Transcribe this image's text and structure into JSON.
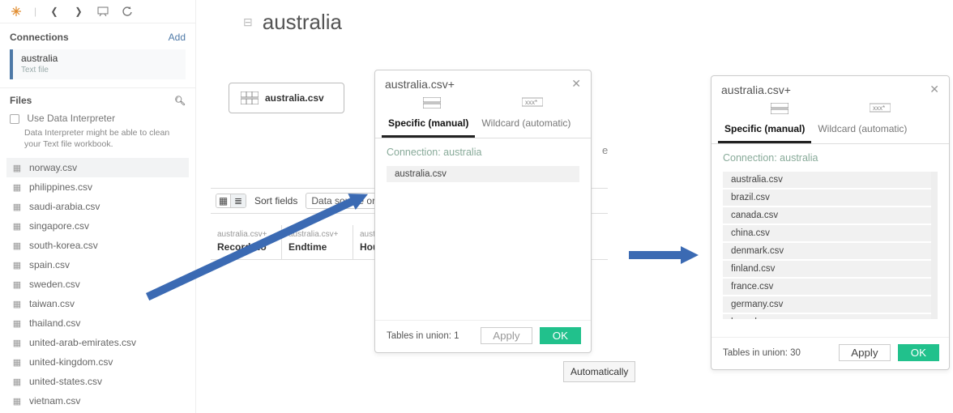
{
  "toolbar": {
    "backIcon": "back-icon",
    "fwdIcon": "forward-icon",
    "screenIcon": "presentation-icon",
    "refreshIcon": "refresh-icon"
  },
  "connections": {
    "heading": "Connections",
    "addLabel": "Add",
    "active": {
      "name": "australia",
      "type": "Text file"
    }
  },
  "files": {
    "heading": "Files",
    "interpreter": {
      "checkboxLabel": "Use Data Interpreter",
      "description": "Data Interpreter might be able to clean your Text file workbook."
    },
    "items": [
      "norway.csv",
      "philippines.csv",
      "saudi-arabia.csv",
      "singapore.csv",
      "south-korea.csv",
      "spain.csv",
      "sweden.csv",
      "taiwan.csv",
      "thailand.csv",
      "united-arab-emirates.csv",
      "united-kingdom.csv",
      "united-states.csv",
      "vietnam.csv"
    ]
  },
  "datasource": {
    "title": "australia",
    "unionPill": "australia.csv",
    "sortLabel": "Sort fields",
    "orderLabel": "Data source order",
    "columns": [
      {
        "src": "australia.csv+",
        "name": "Record No"
      },
      {
        "src": "australia.csv+",
        "name": "Endtime"
      },
      {
        "src": "australia.csv+",
        "name": "Hou"
      }
    ],
    "fieldnameBtn": "e N",
    "autoBtn": "Automatically"
  },
  "dialogLeft": {
    "title": "australia.csv+",
    "tabSpecific": "Specific (manual)",
    "tabWildcard": "Wildcard (automatic)",
    "connLabel": "Connection: australia",
    "items": [
      "australia.csv"
    ],
    "footerCount": "Tables in union: 1",
    "applyLabel": "Apply",
    "okLabel": "OK"
  },
  "dialogRight": {
    "title": "australia.csv+",
    "tabSpecific": "Specific (manual)",
    "tabWildcard": "Wildcard (automatic)",
    "connLabel": "Connection: australia",
    "items": [
      "australia.csv",
      "brazil.csv",
      "canada.csv",
      "china.csv",
      "denmark.csv",
      "finland.csv",
      "france.csv",
      "germany.csv",
      "hong-kong.csv"
    ],
    "footerCount": "Tables in union: 30",
    "applyLabel": "Apply",
    "okLabel": "OK"
  }
}
